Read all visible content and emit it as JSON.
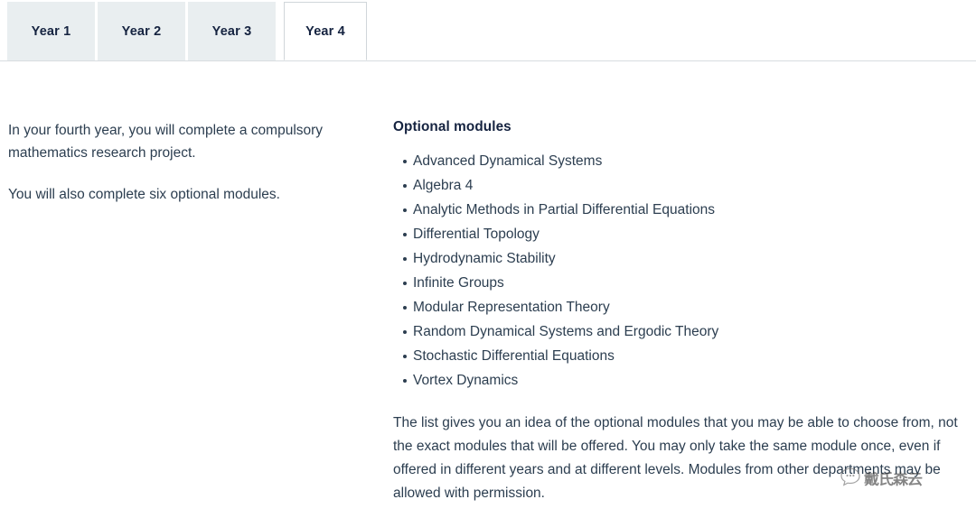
{
  "tabs": [
    {
      "label": "Year 1",
      "active": false
    },
    {
      "label": "Year 2",
      "active": false
    },
    {
      "label": "Year 3",
      "active": false
    },
    {
      "label": "Year 4",
      "active": true
    }
  ],
  "left_column": {
    "paragraph_1": "In your fourth year, you will complete a compulsory mathematics research project.",
    "paragraph_2": "You will also complete six optional modules."
  },
  "right_column": {
    "heading": "Optional modules",
    "modules": [
      "Advanced Dynamical Systems",
      "Algebra 4",
      "Analytic Methods in Partial Differential Equations",
      "Differential Topology",
      "Hydrodynamic Stability",
      "Infinite Groups",
      "Modular Representation Theory",
      "Random Dynamical Systems and Ergodic Theory",
      "Stochastic Differential Equations",
      "Vortex Dynamics"
    ],
    "note": "The list gives you an idea of the optional modules that you may be able to choose from, not the exact modules that will be offered. You may only take the same module once, even if offered in different years and at different levels. Modules from other departments may be allowed with permission."
  },
  "watermark": {
    "text": "戴氏森云",
    "logo_icon": "speech-bubble-icon"
  },
  "colors": {
    "tab_active_bg": "#ffffff",
    "tab_inactive_bg": "#e9eef0",
    "tab_label": "#152340",
    "body_text": "#2c3e50",
    "heading": "#152340",
    "border": "#d8dde0"
  }
}
